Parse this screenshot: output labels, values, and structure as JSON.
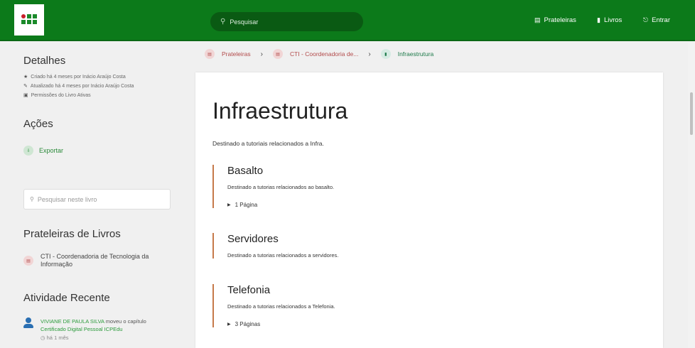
{
  "header": {
    "search_placeholder": "Pesquisar",
    "nav": [
      {
        "label": "Prateleiras",
        "icon": "shelves-icon"
      },
      {
        "label": "Livros",
        "icon": "books-icon"
      },
      {
        "label": "Entrar",
        "icon": "login-icon"
      }
    ]
  },
  "sidebar": {
    "details_title": "Detalhes",
    "meta": [
      "Criado há 4 meses por Inácio Araújo Costa",
      "Atualizado há 4 meses por Inácio Araújo Costa",
      "Permissões do Livro Ativas"
    ],
    "actions_title": "Ações",
    "export_label": "Exportar",
    "book_search_placeholder": "Pesquisar neste livro",
    "shelves_title": "Prateleiras de Livros",
    "shelf_item": "CTI - Coordenadoria de Tecnologia da Informação",
    "recent_title": "Atividade Recente",
    "activity": {
      "user": "VIVIANE DE PAULA SILVA",
      "action": "moveu o capítulo",
      "target": "Certificado Digital Pessoal ICPEdu",
      "time": "há 1 mês"
    }
  },
  "breadcrumb": {
    "items": [
      "Prateleiras",
      "CTI - Coordenadoria de...",
      "Infraestrutura"
    ]
  },
  "book": {
    "title": "Infraestrutura",
    "description": "Destinado a tutoriais relacionados a Infra.",
    "chapters": [
      {
        "title": "Basalto",
        "description": "Destinado a tutorias relacionados ao basalto.",
        "pages": "1 Página"
      },
      {
        "title": "Servidores",
        "description": "Destinado a tutorias relacionados a servidores.",
        "pages": ""
      },
      {
        "title": "Telefonia",
        "description": "Destinado a tutorias relacionados a Telefonia.",
        "pages": "3 Páginas"
      }
    ]
  },
  "colors": {
    "header_green": "#0c7a1a",
    "chapter_border": "#c6794a",
    "link_red": "#b24a4a"
  }
}
